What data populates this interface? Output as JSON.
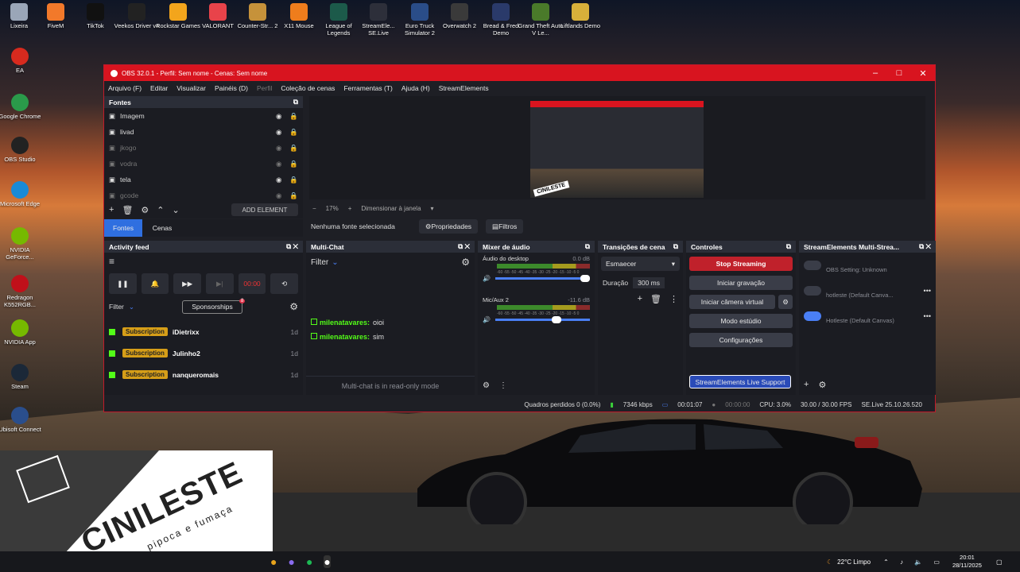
{
  "desktop": {
    "icons": [
      {
        "label": "Lixeira",
        "color": "#9aa6b8"
      },
      {
        "label": "FiveM",
        "color": "#f2792a"
      },
      {
        "label": "TikTok",
        "color": "#111"
      },
      {
        "label": "Veekos Driver v4",
        "color": "#222"
      },
      {
        "label": "Rockstar Games",
        "color": "#f3a51c"
      },
      {
        "label": "VALORANT",
        "color": "#e8434a"
      },
      {
        "label": "Counter-Str... 2",
        "color": "#c6923a"
      },
      {
        "label": "X11 Mouse",
        "color": "#ef7d1c"
      },
      {
        "label": "League of Legends",
        "color": "#1c5a4a"
      },
      {
        "label": "StreamEle... SE.Live",
        "color": "#2d2f3a"
      },
      {
        "label": "Euro Truck Simulator 2",
        "color": "#2a4d88"
      },
      {
        "label": "Overwatch 2",
        "color": "#3a3a3a"
      },
      {
        "label": "Bread & Fred Demo",
        "color": "#2a3a6a"
      },
      {
        "label": "Grand Theft Auto V Le...",
        "color": "#4a7a2a"
      },
      {
        "label": "Liftlands Demo",
        "color": "#d8b03a"
      }
    ],
    "left_icons": [
      {
        "label": "EA",
        "color": "#d72a1e"
      },
      {
        "label": "Google Chrome",
        "color": "#2a9a4a"
      },
      {
        "label": "OBS Studio",
        "color": "#222"
      },
      {
        "label": "Microsoft Edge",
        "color": "#1a8ad6"
      },
      {
        "label": "NVIDIA GeForce...",
        "color": "#76b900"
      },
      {
        "label": "Redragon K552RGB...",
        "color": "#c0101a"
      },
      {
        "label": "NVIDIA App",
        "color": "#76b900"
      },
      {
        "label": "Steam",
        "color": "#1b2838"
      },
      {
        "label": "Ubisoft Connect",
        "color": "#2a4e8c"
      }
    ]
  },
  "obs": {
    "title": "OBS 32.0.1 - Perfil: Sem nome - Cenas: Sem nome",
    "menu": [
      "Arquivo (F)",
      "Editar",
      "Visualizar",
      "Painéis (D)",
      "Perfil",
      "Coleção de cenas",
      "Ferramentas (T)",
      "Ajuda (H)",
      "StreamElements"
    ],
    "sources_title": "Fontes",
    "sources": [
      {
        "name": "Imagem",
        "dim": false
      },
      {
        "name": "livad",
        "dim": false
      },
      {
        "name": "jkogo",
        "dim": true
      },
      {
        "name": "vodra",
        "dim": true
      },
      {
        "name": "tela",
        "dim": false
      },
      {
        "name": "gcode",
        "dim": true
      }
    ],
    "add_element": "ADD ELEMENT",
    "tabs": [
      "Fontes",
      "Cenas"
    ],
    "preview_zoom": "17%",
    "preview_fit": "Dimensionar à janela",
    "no_source": "Nenhuma fonte selecionada",
    "properties": "Propriedades",
    "filters": "Filtros",
    "activity": {
      "title": "Activity feed",
      "timer": "00:00",
      "filter": "Filter",
      "sponsorships": "Sponsorships",
      "badge": "8",
      "items": [
        {
          "tag": "Subscription",
          "user": "iDietrixx",
          "ago": "1d"
        },
        {
          "tag": "Subscription",
          "user": "Julinho2",
          "ago": "1d"
        },
        {
          "tag": "Subscription",
          "user": "nanqueromais",
          "ago": "1d"
        }
      ]
    },
    "multichat": {
      "title": "Multi-Chat",
      "filter": "Filter",
      "messages": [
        {
          "user": "milenatavares:",
          "text": "oioi"
        },
        {
          "user": "milenatavares:",
          "text": "sim"
        }
      ],
      "readonly": "Multi-chat is in read-only mode"
    },
    "mixer": {
      "title": "Mixer de áudio",
      "channels": [
        {
          "name": "Áudio do desktop",
          "db": "0.0 dB"
        },
        {
          "name": "Mic/Aux 2",
          "db": "-11.6 dB"
        }
      ],
      "ticks": "-60 -55 -50 -45 -40 -35 -30 -25 -20 -15 -10 -5 0"
    },
    "transitions": {
      "title": "Transições de cena",
      "type": "Esmaecer",
      "duration_label": "Duração",
      "duration": "300 ms"
    },
    "controls": {
      "title": "Controles",
      "buttons": [
        "Stop Streaming",
        "Iniciar gravação",
        "Iniciar câmera virtual",
        "Modo estúdio",
        "Configurações"
      ],
      "support": "StreamElements Live Support"
    },
    "se": {
      "title": "StreamElements Multi-Strea...",
      "items": [
        {
          "name": "OBS Setting: Unknown",
          "on": false
        },
        {
          "name": "hotleste (Default Canva...",
          "on": false
        },
        {
          "name": "Hotleste (Default Canvas)",
          "on": true
        }
      ]
    },
    "status": {
      "dropped": "Quadros perdidos 0 (0.0%)",
      "kbps": "7346 kbps",
      "stream_time": "00:01:07",
      "rec_time": "00:00:00",
      "cpu": "CPU: 3.0%",
      "fps": "30.00 / 30.00 FPS",
      "version": "SE.Live 25.10.26.520"
    }
  },
  "overlay": {
    "brand": "CINILESTE",
    "tagline": "pipoca e fumaça",
    "preview_brand": "CINILESTE"
  },
  "taskbar": {
    "weather": "22°C Limpo",
    "time": "20:01",
    "date": "28/11/2025"
  }
}
